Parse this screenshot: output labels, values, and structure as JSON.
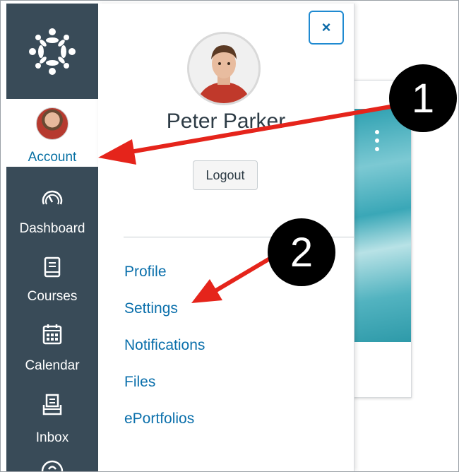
{
  "nav": {
    "items": [
      {
        "label": "Account",
        "icon": "account-avatar",
        "active": true
      },
      {
        "label": "Dashboard",
        "icon": "dashboard-gauge-icon",
        "active": false
      },
      {
        "label": "Courses",
        "icon": "courses-book-icon",
        "active": false
      },
      {
        "label": "Calendar",
        "icon": "calendar-icon",
        "active": false
      },
      {
        "label": "Inbox",
        "icon": "inbox-icon",
        "active": false
      }
    ]
  },
  "tray": {
    "close_label": "×",
    "user_name": "Peter Parker",
    "logout_label": "Logout",
    "links": [
      "Profile",
      "Settings",
      "Notifications",
      "Files",
      "ePortfolios"
    ]
  },
  "annotations": {
    "callout_1": "1",
    "callout_2": "2"
  },
  "colors": {
    "nav_bg": "#394b58",
    "link": "#0a6fab",
    "arrow": "#e5241b",
    "close_border": "#1f8ad1"
  }
}
